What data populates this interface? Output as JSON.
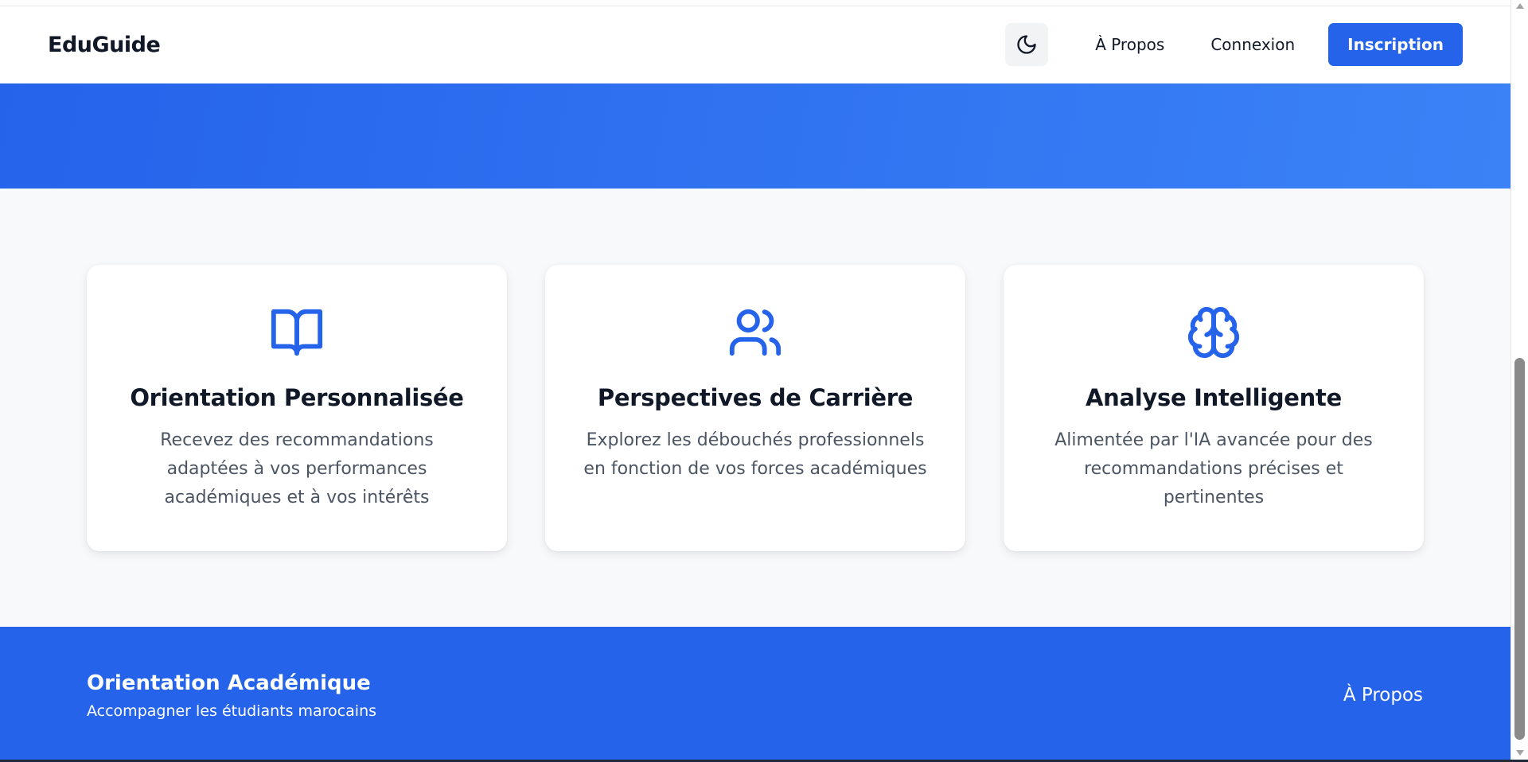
{
  "navbar": {
    "brand": "EduGuide",
    "theme_toggle_icon": "moon-icon",
    "about_label": "À Propos",
    "login_label": "Connexion",
    "signup_label": "Inscription"
  },
  "features": [
    {
      "icon": "book-open-icon",
      "title": "Orientation Personnalisée",
      "description": "Recevez des recommandations adaptées à vos performances académiques et à vos intérêts"
    },
    {
      "icon": "users-icon",
      "title": "Perspectives de Carrière",
      "description": "Explorez les débouchés professionnels en fonction de vos forces académiques"
    },
    {
      "icon": "brain-icon",
      "title": "Analyse Intelligente",
      "description": "Alimentée par l'IA avancée pour des recommandations précises et pertinentes"
    }
  ],
  "footer": {
    "title": "Orientation Académique",
    "subtitle": "Accompagner les étudiants marocains",
    "about_label": "À Propos"
  },
  "colors": {
    "primary": "#2563eb",
    "primary_light": "#3b82f6",
    "page_background": "#f8f9fb",
    "card_background": "#ffffff",
    "text_dark": "#111827",
    "text_muted": "#4b5563"
  }
}
